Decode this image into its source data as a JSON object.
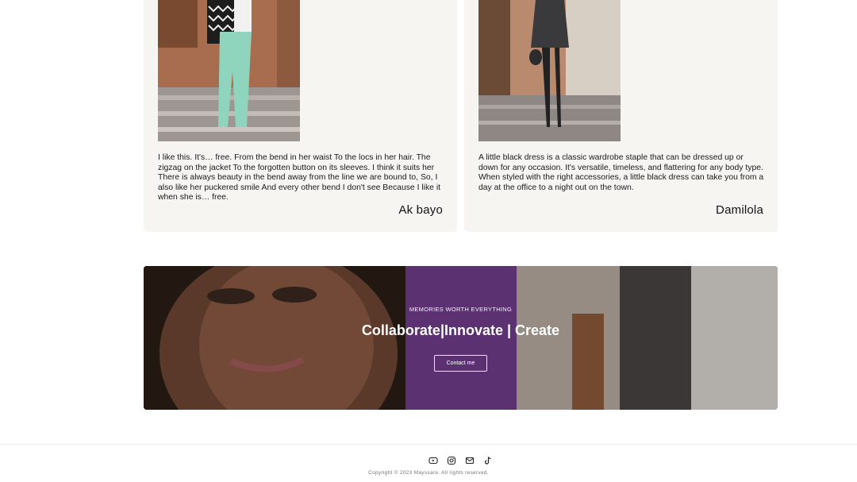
{
  "testimonials": [
    {
      "quote": "I like this. It's… free. From the bend in her waist To the locs in her hair. The zigzag on the jacket To the forgotten button on its sleeves. I think it suits her There is always beauty in the bend away from the line we are bound to, So, I also like her puckered smile And every other bend I don't see Because I like it when she is… free.",
      "author": "Ak bayo"
    },
    {
      "quote": "A little black dress is a classic wardrobe staple that can be dressed up or down for any occasion. It's versatile, timeless, and flattering for any body type. When styled with the right accessories, a little black dress can take you from a day at the office to a night out on the town.",
      "author": "Damilola"
    }
  ],
  "banner": {
    "kicker": "MEMORIES WORTH EVERYTHING",
    "title": "Collaborate|Innovate | Create",
    "button_label": "Contact me"
  },
  "footer": {
    "social_icons": [
      "youtube-icon",
      "instagram-icon",
      "mail-icon",
      "tiktok-icon"
    ],
    "copyright": "Copyright © 2023 Mayssare. All rights reserved."
  }
}
